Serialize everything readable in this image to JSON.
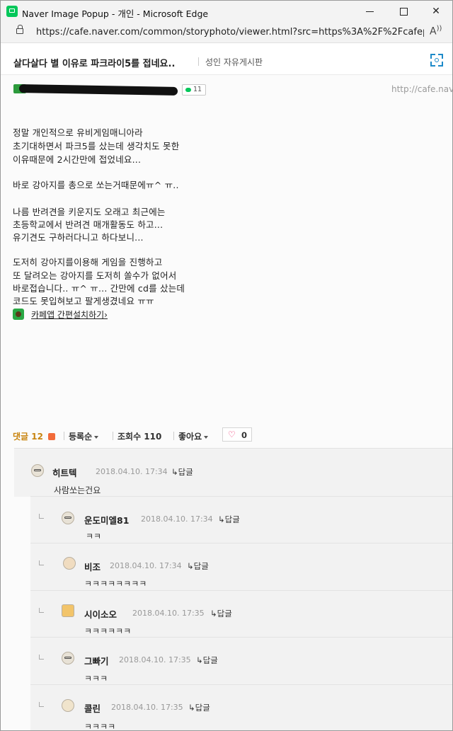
{
  "window": {
    "title": "Naver Image Popup - 개인 - Microsoft Edge",
    "minimize_glyph": "",
    "close_glyph": "✕"
  },
  "address_bar": {
    "url": "https://cafe.naver.com/common/storyphoto/viewer.html?src=https%3A%2F%2Fcafep...",
    "read_aloud_glyph": "A͡"
  },
  "post": {
    "title": "살다살다 별 이유로 파크라이5를 접네요..",
    "board": "성인 자유게시판",
    "comment_count": "11",
    "side_url": "http://cafe.nav",
    "body": [
      "정말 개인적으로 유비게임매니아라",
      "초기대하면서 파크5를 샀는데 생각치도 못한",
      "이유때문에 2시간만에 접었네요...",
      "",
      "바로 강아지를 총으로 쏘는거때문에ㅠ^ ㅠ..",
      "",
      "나름 반려견을 키운지도 오래고 최근에는",
      "초등학교에서 반려견 매개활동도 하고...",
      "유기견도 구하러다니고 하다보니...",
      "",
      "도저히 강아지를이용해 게임을 진행하고",
      "또 달려오는 강아지를 도저히 쏠수가 없어서",
      "바로접습니다.. ㅠ^ ㅠ... 간만에 cd를 샀는데",
      "코드도 못입혀보고 팔게생겼네요 ㅠㅠ"
    ],
    "cafe_app_link": "카페앱 간편설치하기›"
  },
  "comment_bar": {
    "reply_label": "댓글",
    "reply_count": "12",
    "sort_label": "등록순",
    "views_label": "조회수 110",
    "likes_label": "좋아요",
    "like_heart": "♡",
    "like_count": "0"
  },
  "comments": [
    {
      "nick": "히트텍",
      "date": "2018.04.10. 17:34",
      "reply": "답글",
      "text": "사람쏘는건요"
    },
    {
      "nick": "운도미엘81",
      "date": "2018.04.10. 17:34",
      "reply": "답글",
      "text": "ㅋㅋ"
    },
    {
      "nick": "비조",
      "date": "2018.04.10. 17:34",
      "reply": "답글",
      "text": "ㅋㅋㅋㅋㅋㅋㅋㅋ"
    },
    {
      "nick": "시이소오",
      "date": "2018.04.10. 17:35",
      "reply": "답글",
      "text": "ㅋㅋㅋㅋㅋㅋ"
    },
    {
      "nick": "그빠기",
      "date": "2018.04.10. 17:35",
      "reply": "답글",
      "text": "ㅋㅋㅋ"
    },
    {
      "nick": "콜린",
      "date": "2018.04.10. 17:35",
      "reply": "답글",
      "text": "ㅋㅋㅋㅋ"
    }
  ],
  "colors": {
    "accent_blue": "#1d8ac9",
    "naver_green": "#03c75a",
    "reply_orange": "#c8840f"
  }
}
